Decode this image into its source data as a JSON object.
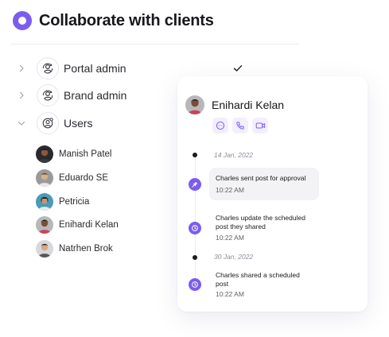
{
  "header": {
    "title": "Collaborate with clients"
  },
  "nav": [
    {
      "label": "Portal admin",
      "icon": "portal-admin-icon",
      "expanded": false,
      "checked": true
    },
    {
      "label": "Brand admin",
      "icon": "brand-admin-icon",
      "expanded": false,
      "checked": false
    },
    {
      "label": "Users",
      "icon": "users-icon",
      "expanded": true,
      "checked": false
    }
  ],
  "users": [
    {
      "name": "Manish Patel"
    },
    {
      "name": "Eduardo SE"
    },
    {
      "name": "Petricia"
    },
    {
      "name": "Enihardi Kelan"
    },
    {
      "name": "Natrhen Brok"
    }
  ],
  "card": {
    "name": "Enihardi Kelan",
    "actions": [
      "chat-icon",
      "phone-icon",
      "video-icon"
    ],
    "timeline": [
      {
        "type": "date",
        "text": "14 Jan, 2022"
      },
      {
        "type": "event",
        "icon": "pin-icon",
        "text": "Charles sent post for approval",
        "time": "10:22 AM",
        "highlighted": true
      },
      {
        "type": "event",
        "icon": "clock-icon",
        "text": "Charles update the scheduled post they shared",
        "time": "10:22 AM"
      },
      {
        "type": "date",
        "text": "30 Jan, 2022"
      },
      {
        "type": "event",
        "icon": "clock-icon",
        "text": "Charles shared a scheduled post",
        "time": "10:22 AM"
      }
    ]
  },
  "colors": {
    "accent": "#7c5cf0",
    "accent_soft": "#f3efff",
    "text": "#1b1b1f",
    "muted": "#8d8d98"
  }
}
